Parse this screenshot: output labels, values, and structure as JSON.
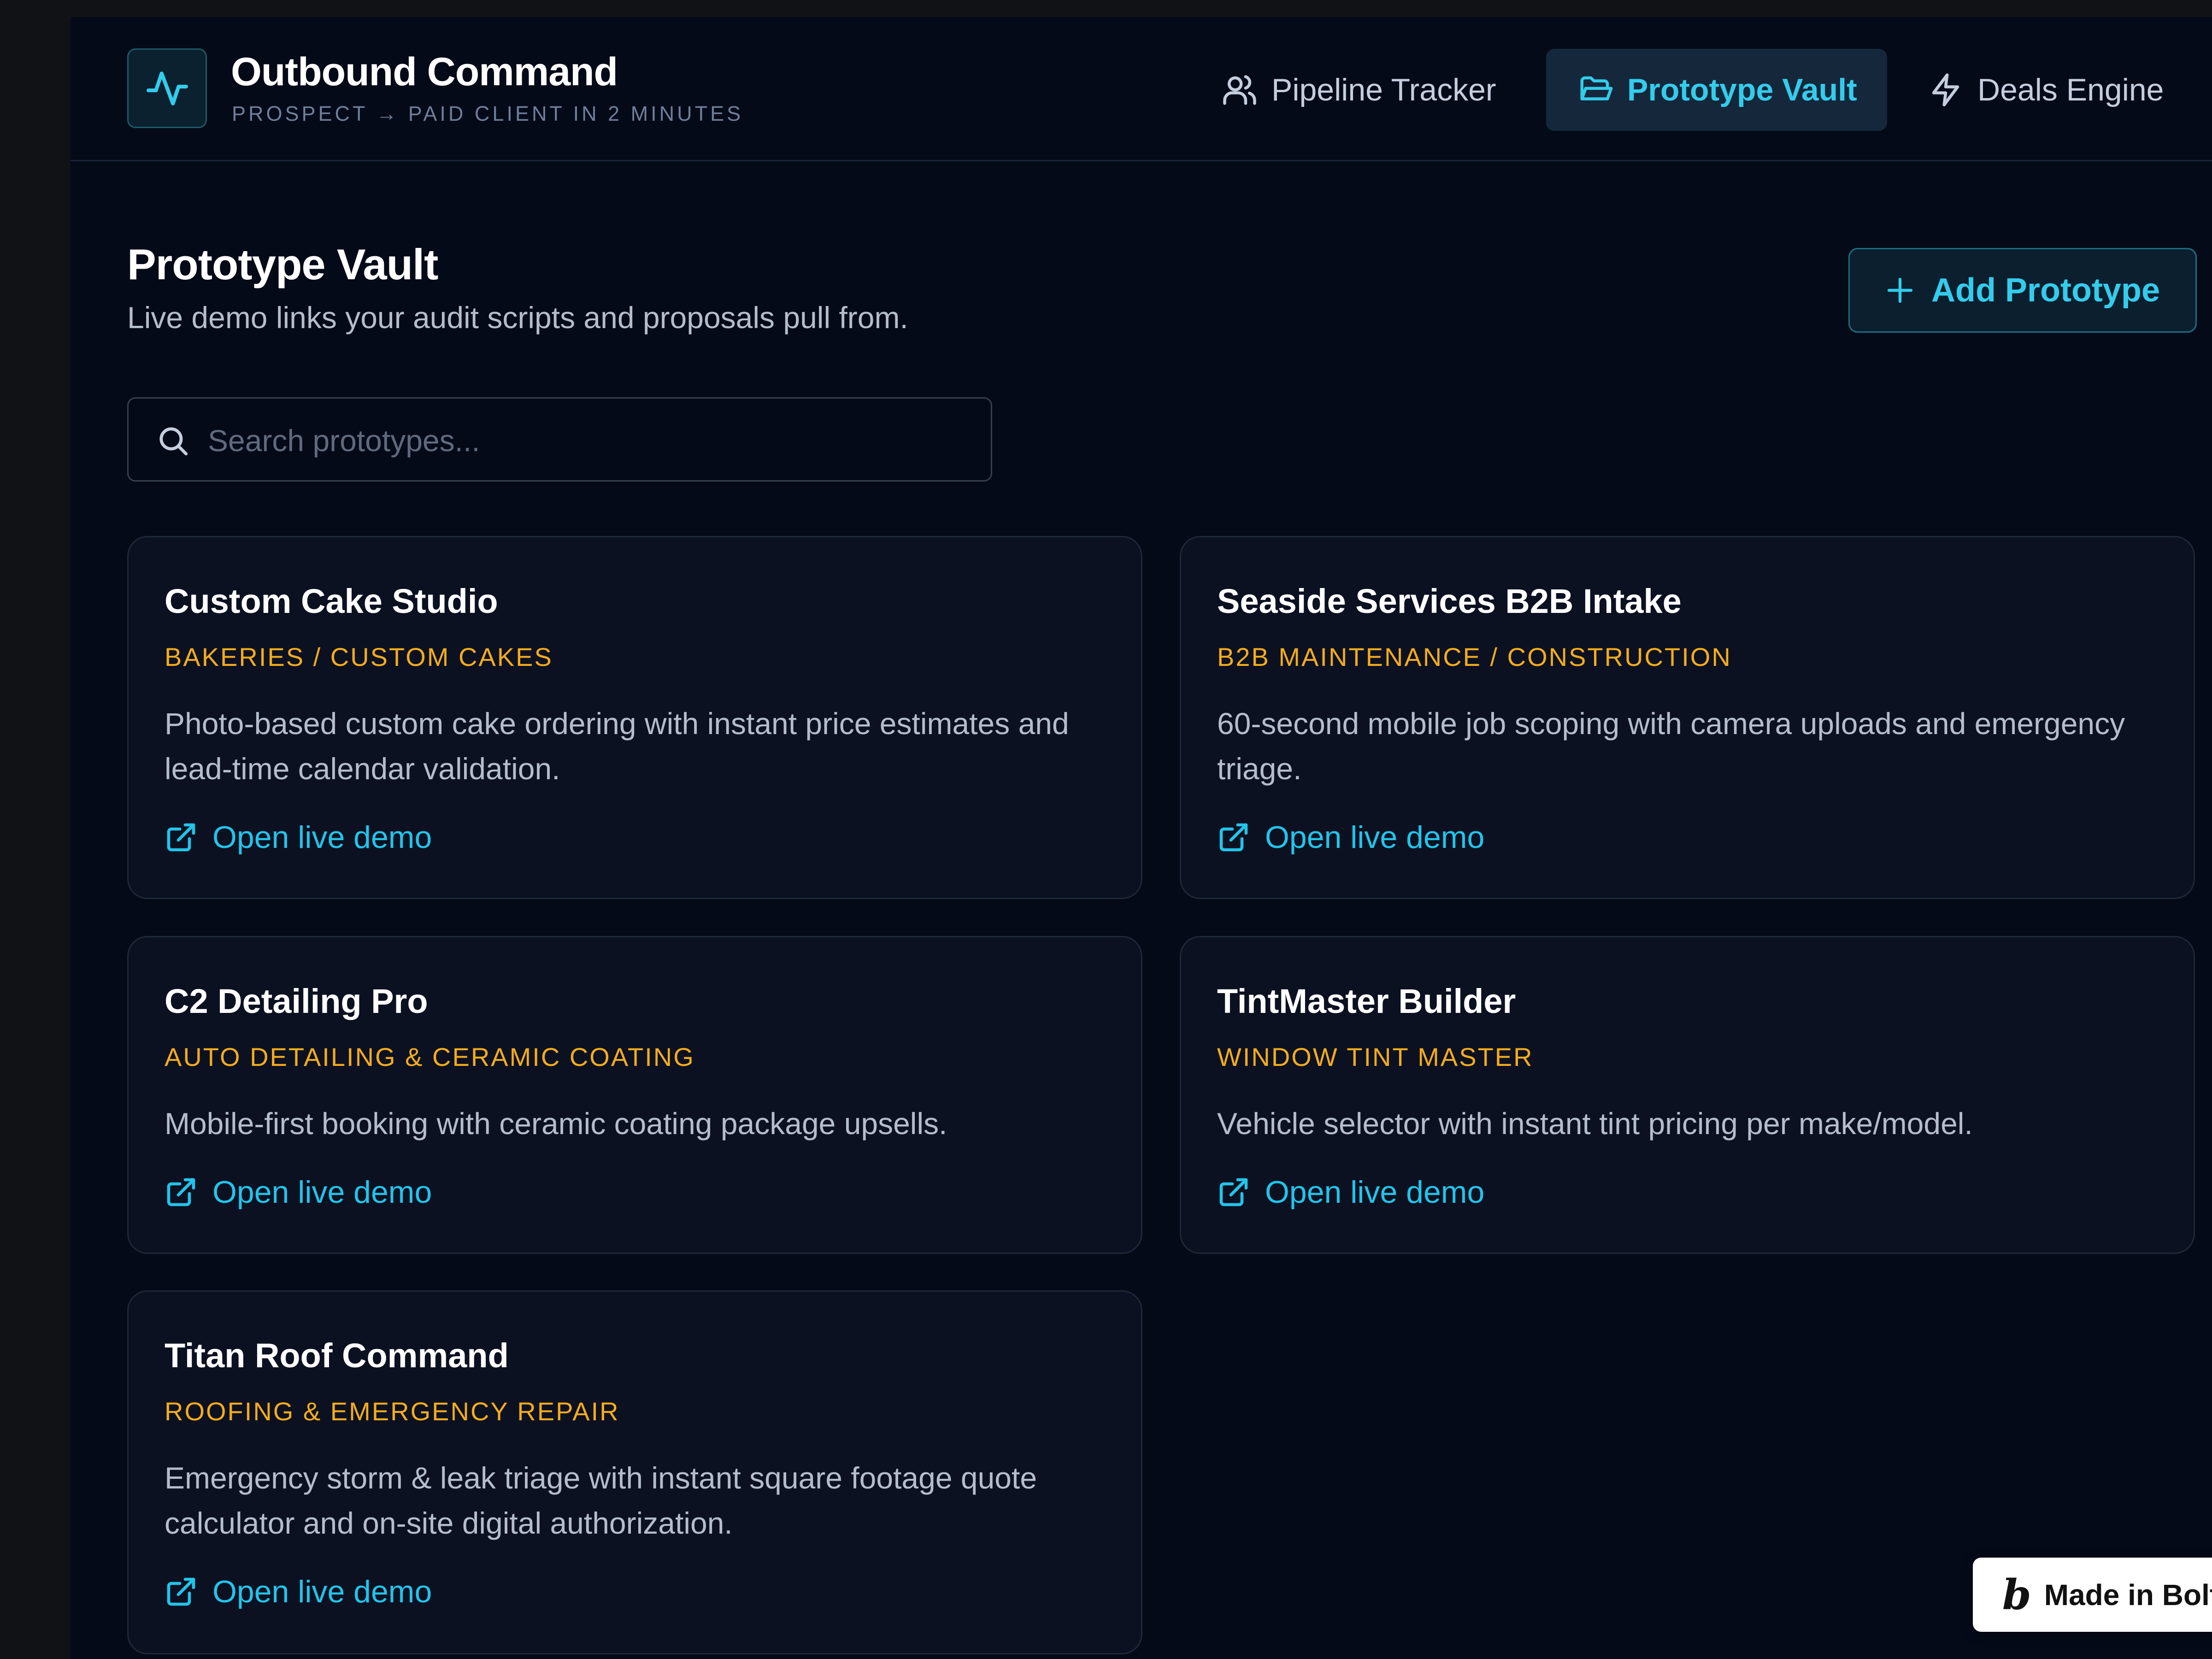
{
  "header": {
    "title": "Outbound Command",
    "subtitle": "PROSPECT → PAID CLIENT IN 2 MINUTES",
    "logo_icon": "activity-pulse-icon",
    "nav": [
      {
        "label": "Pipeline Tracker",
        "icon": "users-icon",
        "active": false
      },
      {
        "label": "Prototype Vault",
        "icon": "folder-icon",
        "active": true
      },
      {
        "label": "Deals Engine",
        "icon": "lightning-icon",
        "active": false
      }
    ]
  },
  "page": {
    "title": "Prototype Vault",
    "subtitle": "Live demo links your audit scripts and proposals pull from.",
    "add_button_label": "Add Prototype"
  },
  "search": {
    "value": "",
    "placeholder": "Search prototypes..."
  },
  "prototypes": [
    {
      "title": "Custom Cake Studio",
      "category": "BAKERIES / CUSTOM CAKES",
      "description": "Photo-based custom cake ordering with instant price estimates and lead-time calendar validation.",
      "link_label": "Open live demo"
    },
    {
      "title": "Seaside Services B2B Intake",
      "category": "B2B MAINTENANCE / CONSTRUCTION",
      "description": "60-second mobile job scoping with camera uploads and emergency triage.",
      "link_label": "Open live demo"
    },
    {
      "title": "C2 Detailing Pro",
      "category": "AUTO DETAILING & CERAMIC COATING",
      "description": "Mobile-first booking with ceramic coating package upsells.",
      "link_label": "Open live demo"
    },
    {
      "title": "TintMaster Builder",
      "category": "WINDOW TINT MASTER",
      "description": "Vehicle selector with instant tint pricing per make/model.",
      "link_label": "Open live demo"
    },
    {
      "title": "Titan Roof Command",
      "category": "ROOFING & EMERGENCY REPAIR",
      "description": "Emergency storm & leak triage with instant square footage quote calculator and on-site digital authorization.",
      "link_label": "Open live demo"
    }
  ],
  "badge": {
    "label": "Made in Bolt",
    "logo_letter": "b"
  },
  "colors": {
    "background": "#050a18",
    "accent": "#33ccec",
    "category": "#f5ac1c",
    "card": "#0b1121"
  }
}
